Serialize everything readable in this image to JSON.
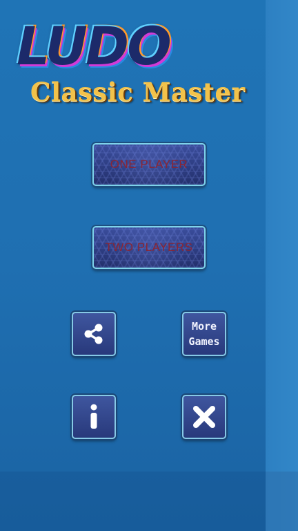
{
  "title": {
    "main": "LUDO",
    "subtitle": "Classic Master"
  },
  "menu": {
    "one_player": "ONE PLAYER",
    "two_players": "TWO PLAYERS"
  },
  "actions": {
    "share_icon": "share-icon",
    "more_games_line1": "More",
    "more_games_line2": "Games",
    "info_icon": "info-icon",
    "close_icon": "close-icon"
  },
  "colors": {
    "background": "#1f6fb1",
    "button_fill": "#2f3f84",
    "button_border": "#7ed3ea",
    "menu_label": "#8a2534",
    "subtitle": "#f2c24a"
  }
}
